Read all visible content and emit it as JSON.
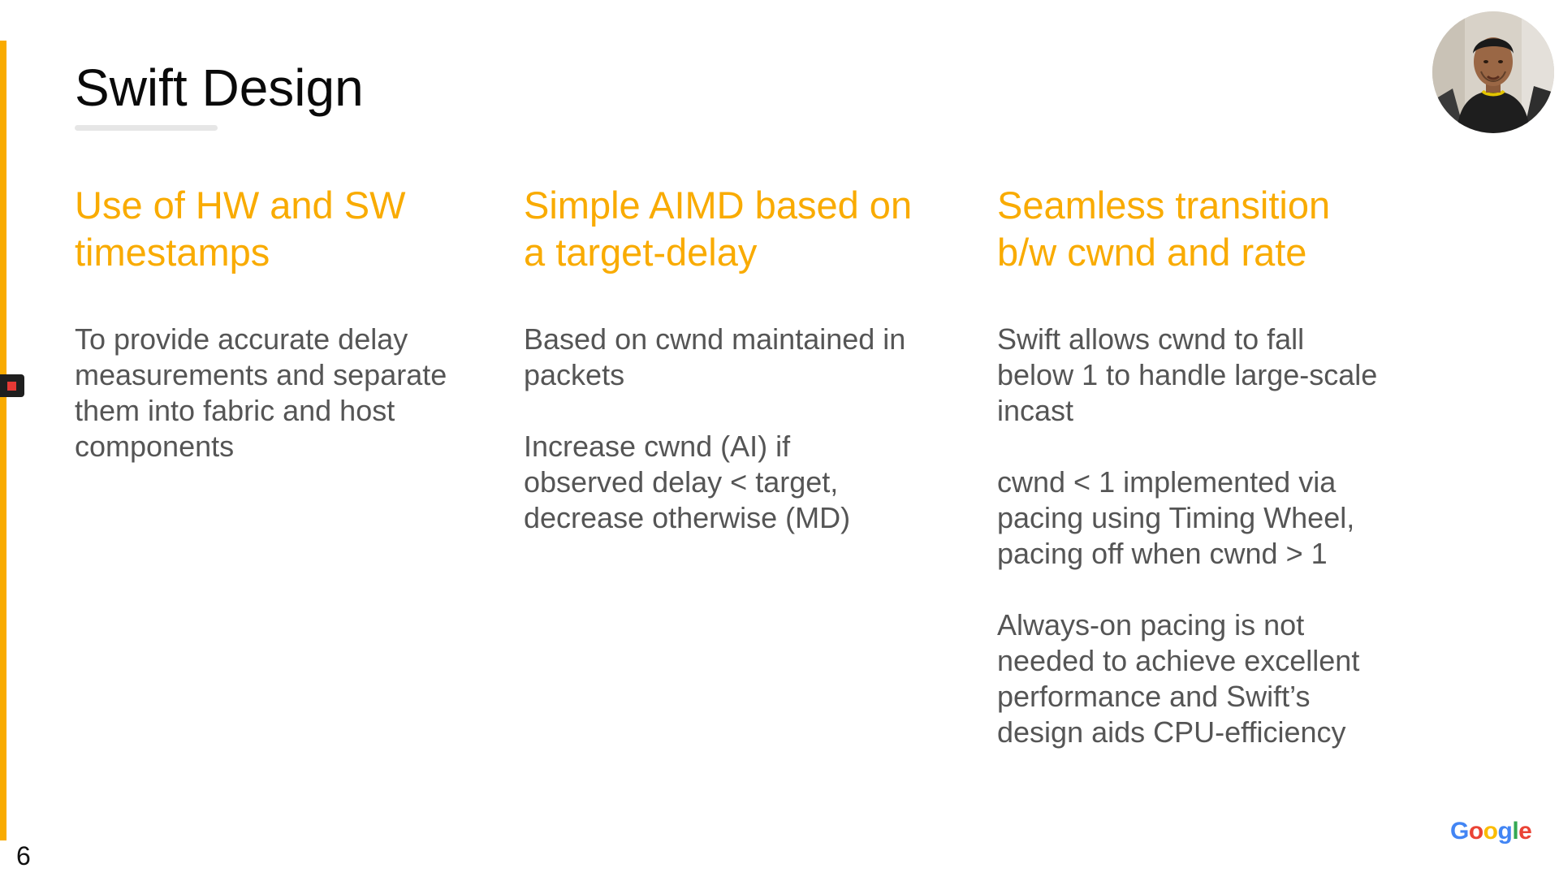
{
  "slide": {
    "title": "Swift Design",
    "page_number": "6",
    "logo_text": "Google",
    "colors": {
      "accent": "#f9ab00",
      "heading": "#f9ab00",
      "body_text": "#555555",
      "title_text": "#0a0a0a"
    }
  },
  "columns": [
    {
      "heading": "Use of HW and SW\ntimestamps",
      "paragraphs": [
        "To provide accurate delay\nmeasurements and separate\nthem into fabric and host\ncomponents"
      ]
    },
    {
      "heading": "Simple AIMD based on\na target-delay",
      "paragraphs": [
        "Based on cwnd maintained in\npackets",
        "Increase cwnd (AI)  if\nobserved delay < target,\ndecrease otherwise (MD)"
      ]
    },
    {
      "heading": "Seamless transition\nb/w cwnd and rate",
      "paragraphs": [
        "Swift allows cwnd to fall\nbelow 1 to handle large-scale\nincast",
        "cwnd < 1 implemented via\npacing using Timing Wheel,\npacing off when cwnd > 1",
        "Always-on pacing is not\nneeded to achieve excellent\nperformance and Swift’s\ndesign aids CPU-efficiency"
      ]
    }
  ],
  "overlay": {
    "webcam_icon": "presenter-webcam",
    "record_icon": "recording-indicator-icon"
  }
}
